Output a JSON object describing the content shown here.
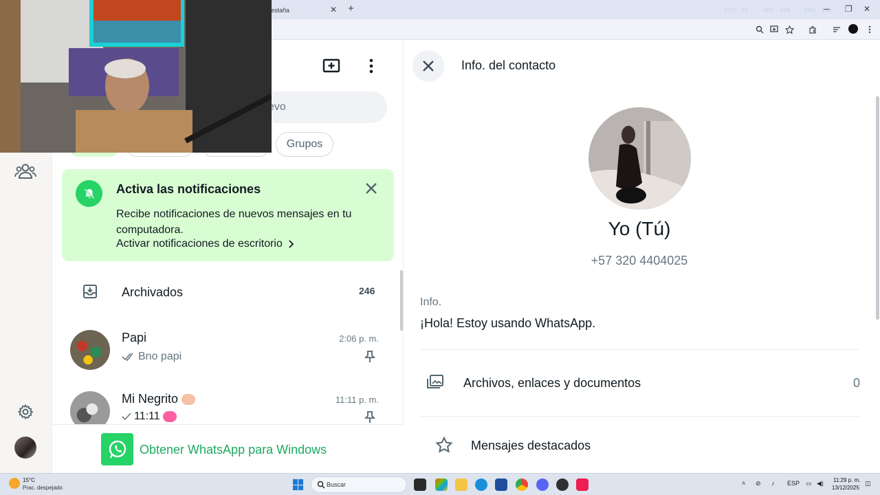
{
  "browser": {
    "tab_title": "estaña",
    "new_tab": "+",
    "overlay": {
      "fps_label": "FPS",
      "fps_value": "27",
      "gpu_label": "GPU",
      "gpu_value": "42%",
      "cpu_label": "CPU",
      "cpu_value": "16%"
    }
  },
  "chatlist": {
    "search_placeholder_tail": "evo",
    "filters": [
      "Grupos"
    ],
    "notification": {
      "title": "Activa las notificaciones",
      "body": "Recibe notificaciones de nuevos mensajes en tu computadora.",
      "link": "Activar notificaciones de escritorio"
    },
    "archived": {
      "label": "Archivados",
      "count": "246"
    },
    "chats": [
      {
        "name": "Papi",
        "time": "2:06 p. m.",
        "preview": "Bno papi",
        "ticks": "double",
        "pinned": true
      },
      {
        "name": "Mi Negrito",
        "time": "11:11 p. m.",
        "preview": "11:11",
        "ticks": "single",
        "pinned": true
      }
    ],
    "get_app": "Obtener WhatsApp para Windows"
  },
  "contact_info": {
    "title": "Info. del contacto",
    "name": "Yo (Tú)",
    "phone": "+57 320 4404025",
    "about_label": "Info.",
    "about_text": "¡Hola! Estoy usando WhatsApp.",
    "rows": [
      {
        "label": "Archivos, enlaces y documentos",
        "count": "0"
      },
      {
        "label": "Mensajes destacados"
      }
    ]
  },
  "taskbar": {
    "weather_temp": "15°C",
    "weather_desc": "Prac. despejado",
    "search_label": "Buscar",
    "language": "ESP",
    "time": "11:29 p. m.",
    "date": "13/12/2025"
  },
  "colors": {
    "accent_green": "#25d366",
    "link_green": "#1daa61",
    "banner_bg": "#d9fdd3"
  }
}
